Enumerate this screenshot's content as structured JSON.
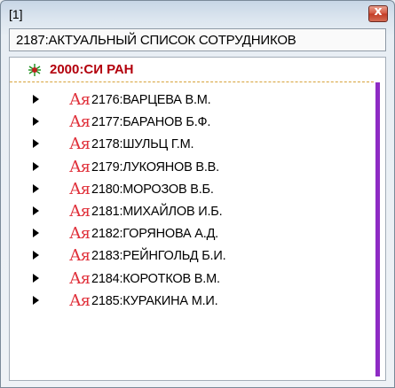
{
  "window": {
    "title": "[1]",
    "close_glyph": "x"
  },
  "list_title": "2187:АКТУАЛЬНЫЙ СПИСОК СОТРУДНИКОВ",
  "tree": {
    "root_label": "2000:СИ РАН",
    "root_icon": "bug-icon",
    "item_icon": "text-document-icon",
    "icon_glyph": "Ая",
    "expand_icon": "triangle-right-icon",
    "items": [
      {
        "label": "2176:ВАРЦЕВА В.М."
      },
      {
        "label": "2177:БАРАНОВ Б.Ф."
      },
      {
        "label": "2178:ШУЛЬЦ Г.М."
      },
      {
        "label": "2179:ЛУКОЯНОВ В.В."
      },
      {
        "label": "2180:МОРОЗОВ В.Б."
      },
      {
        "label": "2181:МИХАЙЛОВ И.Б."
      },
      {
        "label": "2182:ГОРЯНОВА А.Д."
      },
      {
        "label": "2183:РЕЙНГОЛЬД Б.И."
      },
      {
        "label": "2184:КОРОТКОВ В.М."
      },
      {
        "label": "2185:КУРАКИНА М.И."
      }
    ]
  },
  "colors": {
    "accent_purple": "#8e2bc4",
    "root_red": "#b3000c",
    "icon_red": "#e0303a",
    "divider_orange": "#d6a23a",
    "close_red": "#c23a24"
  }
}
